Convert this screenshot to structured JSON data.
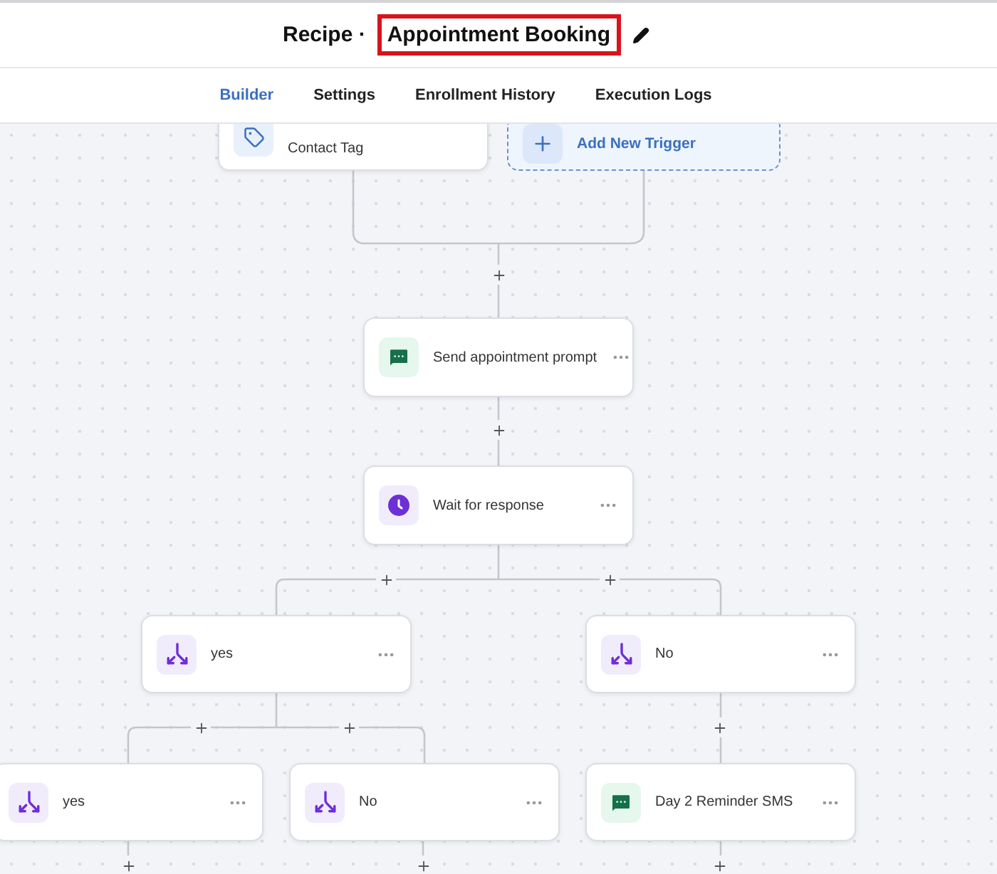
{
  "header": {
    "title": {
      "prefix": "Recipe ·",
      "name": "Appointment Booking",
      "highlighted": true
    }
  },
  "tabs": [
    {
      "label": "Builder",
      "selected": true
    },
    {
      "label": "Settings",
      "selected": false
    },
    {
      "label": "Enrollment History",
      "selected": false
    },
    {
      "label": "Execution Logs",
      "selected": false
    }
  ],
  "canvas": {
    "nodes": [
      {
        "kind": "trigger",
        "label": "Contact Tag"
      },
      {
        "kind": "add",
        "label": "Add New Trigger"
      },
      {
        "kind": "sms",
        "label": "Send appointment prompt"
      },
      {
        "kind": "wait",
        "label": "Wait for response"
      },
      {
        "kind": "branch",
        "label": "yes"
      },
      {
        "kind": "branch",
        "label": "No"
      },
      {
        "kind": "branch",
        "label": "yes"
      },
      {
        "kind": "branch",
        "label": "No"
      },
      {
        "kind": "sms",
        "label": "Day 2 Reminder SMS"
      }
    ]
  }
}
